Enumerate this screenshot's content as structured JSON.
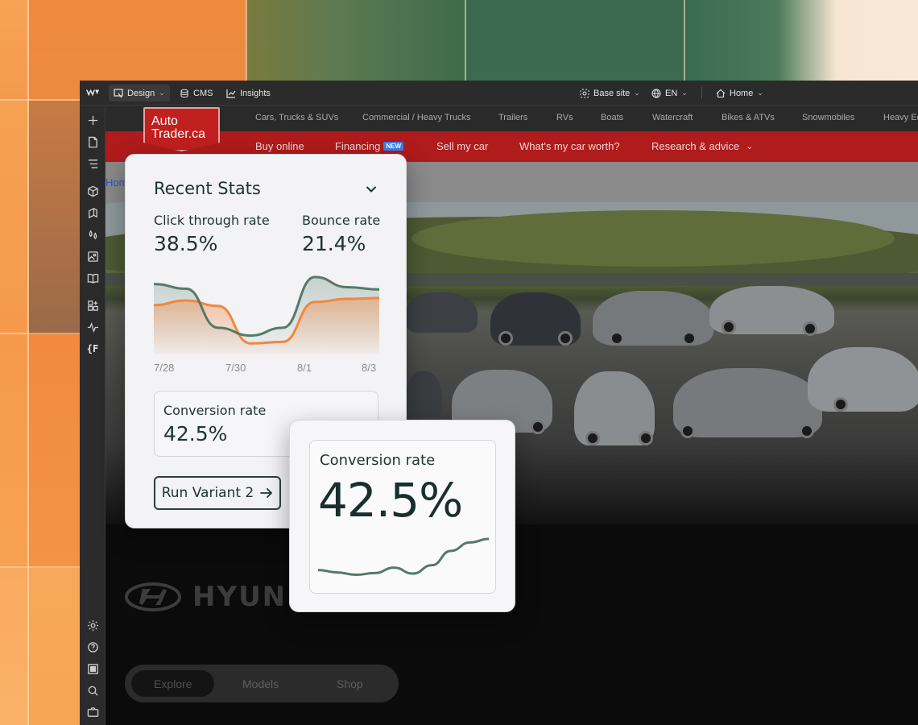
{
  "webflow": {
    "topbar": {
      "design": "Design",
      "cms": "CMS",
      "insights": "Insights",
      "base_site": "Base site",
      "language": "EN",
      "page": "Home"
    }
  },
  "autotrader": {
    "logo_text_1": "Auto",
    "logo_text_2": "Trader.ca",
    "categories": [
      "Cars, Trucks & SUVs",
      "Commercial / Heavy Trucks",
      "Trailers",
      "RVs",
      "Boats",
      "Watercraft",
      "Bikes & ATVs",
      "Snowmobiles",
      "Heavy Ed"
    ],
    "nav": {
      "buy_online": "Buy online",
      "financing": "Financing",
      "financing_badge": "NEW",
      "sell": "Sell my car",
      "worth": "What's my car worth?",
      "research": "Research & advice"
    },
    "breadcrumb": "Hom"
  },
  "hyundai": {
    "brand": "HYUNDAI",
    "pills": [
      "Explore",
      "Models",
      "Shop"
    ]
  },
  "recent_stats": {
    "title": "Recent Stats",
    "ctr_label": "Click through rate",
    "ctr_value": "38.5%",
    "bounce_label": "Bounce rate",
    "bounce_value": "21.4%",
    "conversion_label": "Conversion rate",
    "conversion_value": "42.5%",
    "run_button": "Run Variant 2",
    "colors": {
      "series_green": "#557a68",
      "series_orange": "#f0873e"
    }
  },
  "chart_data": {
    "type": "line",
    "x": [
      "7/28",
      "7/30",
      "8/1",
      "8/3"
    ],
    "series": [
      {
        "values": [
          86,
          80,
          30,
          20,
          30,
          95,
          82,
          79
        ]
      },
      {
        "values": [
          59,
          65,
          58,
          10,
          12,
          63,
          67,
          68
        ]
      }
    ]
  },
  "conversion_card": {
    "label": "Conversion rate",
    "value": "42.5%",
    "sparkline": [
      14,
      10,
      6,
      9,
      18,
      8,
      22,
      46,
      60,
      66
    ]
  }
}
